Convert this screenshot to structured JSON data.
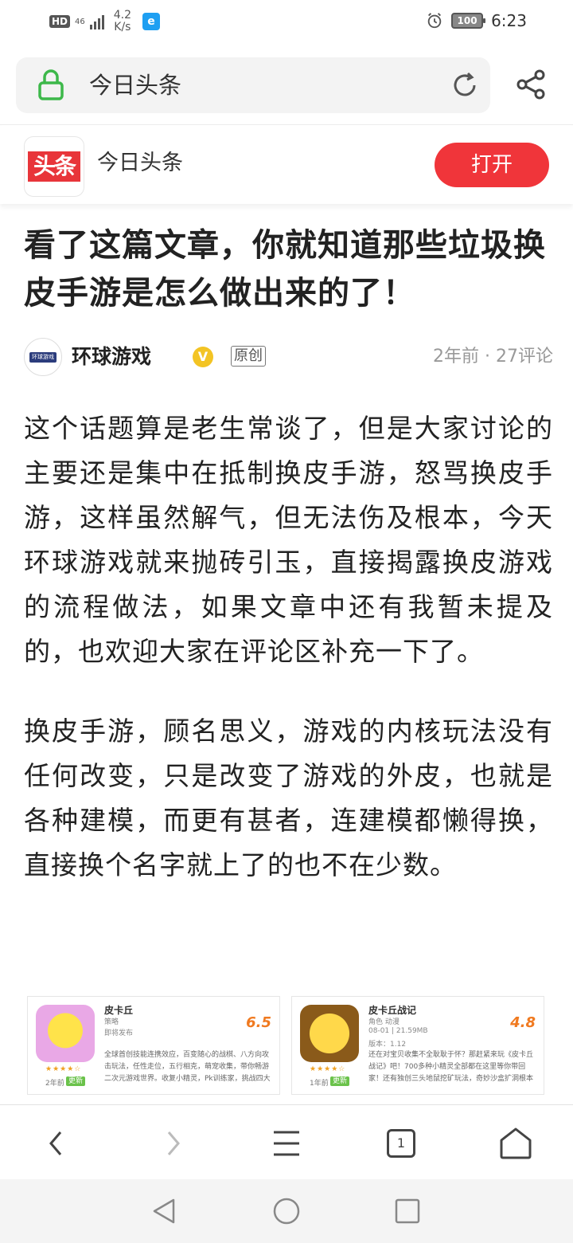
{
  "status_bar": {
    "hd": "HD",
    "network": "46",
    "speed_value": "4.2",
    "speed_unit": "K/s",
    "notification_app_icon": "e",
    "battery": "100",
    "time": "6:23"
  },
  "address_bar": {
    "text": "今日头条"
  },
  "app_banner": {
    "logo_text": "头条",
    "name": "今日头条",
    "open_label": "打开"
  },
  "article": {
    "title": "看了这篇文章，你就知道那些垃圾换皮手游是怎么做出来的了！",
    "author": {
      "avatar_text": "环球游戏",
      "name": "环球游戏",
      "verified_mark": "V",
      "original_badge": "原创",
      "meta": "2年前 · 27评论"
    },
    "paragraphs": [
      "这个话题算是老生常谈了，但是大家讨论的主要还是集中在抵制换皮手游，怒骂换皮手游，这样虽然解气，但无法伤及根本，今天环球游戏就来抛砖引玉，直接揭露换皮游戏的流程做法，如果文章中还有我暂未提及的，也欢迎大家在评论区补充一下了。",
      "换皮手游，顾名思义，游戏的内核玩法没有任何改变，只是改变了游戏的外皮，也就是各种建模，而更有甚者，连建模都懒得换，直接换个名字就上了的也不在少数。"
    ],
    "image_cards": [
      {
        "title": "皮卡丘",
        "category": "策略",
        "sub": "即将发布",
        "sub2": "",
        "score": "6.5",
        "stars": "★★★★☆",
        "age": "2年前",
        "update": "更新",
        "desc": "全球首创技能连携效应，百变随心的战棋、八方向攻击玩法，任性走位，五行相克，萌宠收集，带你畅游二次元游戏世界。收复小精灵，Pk训练家，挑战四大"
      },
      {
        "title": "皮卡丘战记",
        "category": "角色 动漫",
        "sub": "08-01 | 21.59MB",
        "sub2": "版本：1.12",
        "score": "4.8",
        "stars": "★★★★☆",
        "age": "1年前",
        "update": "更新",
        "desc": "还在对宝贝收集不全耿耿于怀？那赶紧来玩《皮卡丘战记》吧！700多种小精灵全部都在这里等你带回家！还有独创三头地鼠挖矿玩法，奇妙沙盒扩洞根本"
      }
    ]
  },
  "toolbar": {
    "tabs_count": "1"
  },
  "icons": {
    "lock": "lock-icon",
    "reload": "reload-icon",
    "share": "share-icon",
    "back": "chevron-left-icon",
    "forward": "chevron-right-icon",
    "menu": "menu-icon",
    "tabs": "tabs-icon",
    "home": "home-icon",
    "alarm": "alarm-icon"
  },
  "colors": {
    "accent_red": "#f0353a",
    "lock_green": "#3db84a",
    "verified_gold": "#f3c424"
  }
}
